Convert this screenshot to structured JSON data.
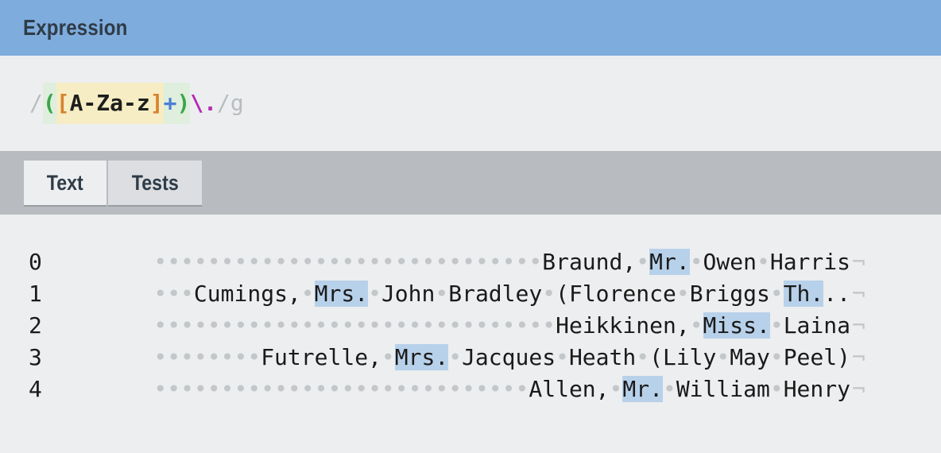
{
  "header": {
    "title": "Expression"
  },
  "expression": {
    "open_delim": "/",
    "open_paren": "(",
    "open_bracket": "[",
    "set_body": "A-Za-z",
    "close_bracket": "]",
    "quantifier": "+",
    "close_paren": ")",
    "escape": "\\.",
    "close_delim": "/",
    "flags": "g"
  },
  "tabs": [
    {
      "label": "Text",
      "active": true
    },
    {
      "label": "Tests",
      "active": false
    }
  ],
  "rows": [
    {
      "index": "0",
      "pad": 29,
      "parts": [
        [
          "Braund,",
          0
        ],
        [
          " ",
          1
        ],
        [
          "Mr.",
          2
        ],
        [
          " ",
          1
        ],
        [
          "Owen",
          0
        ],
        [
          " ",
          1
        ],
        [
          "Harris",
          0
        ]
      ]
    },
    {
      "index": "1",
      "pad": 3,
      "parts": [
        [
          "Cumings,",
          0
        ],
        [
          " ",
          1
        ],
        [
          "Mrs.",
          2
        ],
        [
          " ",
          1
        ],
        [
          "John",
          0
        ],
        [
          " ",
          1
        ],
        [
          "Bradley",
          0
        ],
        [
          " ",
          1
        ],
        [
          "(Florence",
          0
        ],
        [
          " ",
          1
        ],
        [
          "Briggs",
          0
        ],
        [
          " ",
          1
        ],
        [
          "Th.",
          2
        ],
        [
          "..",
          0
        ]
      ]
    },
    {
      "index": "2",
      "pad": 30,
      "parts": [
        [
          "Heikkinen,",
          0
        ],
        [
          " ",
          1
        ],
        [
          "Miss.",
          2
        ],
        [
          " ",
          1
        ],
        [
          "Laina",
          0
        ]
      ]
    },
    {
      "index": "3",
      "pad": 8,
      "parts": [
        [
          "Futrelle,",
          0
        ],
        [
          " ",
          1
        ],
        [
          "Mrs.",
          2
        ],
        [
          " ",
          1
        ],
        [
          "Jacques",
          0
        ],
        [
          " ",
          1
        ],
        [
          "Heath",
          0
        ],
        [
          " ",
          1
        ],
        [
          "(Lily",
          0
        ],
        [
          " ",
          1
        ],
        [
          "May",
          0
        ],
        [
          " ",
          1
        ],
        [
          "Peel)",
          0
        ]
      ]
    },
    {
      "index": "4",
      "pad": 28,
      "parts": [
        [
          "Allen,",
          0
        ],
        [
          " ",
          1
        ],
        [
          "Mr.",
          2
        ],
        [
          " ",
          1
        ],
        [
          "William",
          0
        ],
        [
          " ",
          1
        ],
        [
          "Henry",
          0
        ]
      ]
    }
  ],
  "eol_symbol": "¬",
  "whitespace_symbol": "•"
}
